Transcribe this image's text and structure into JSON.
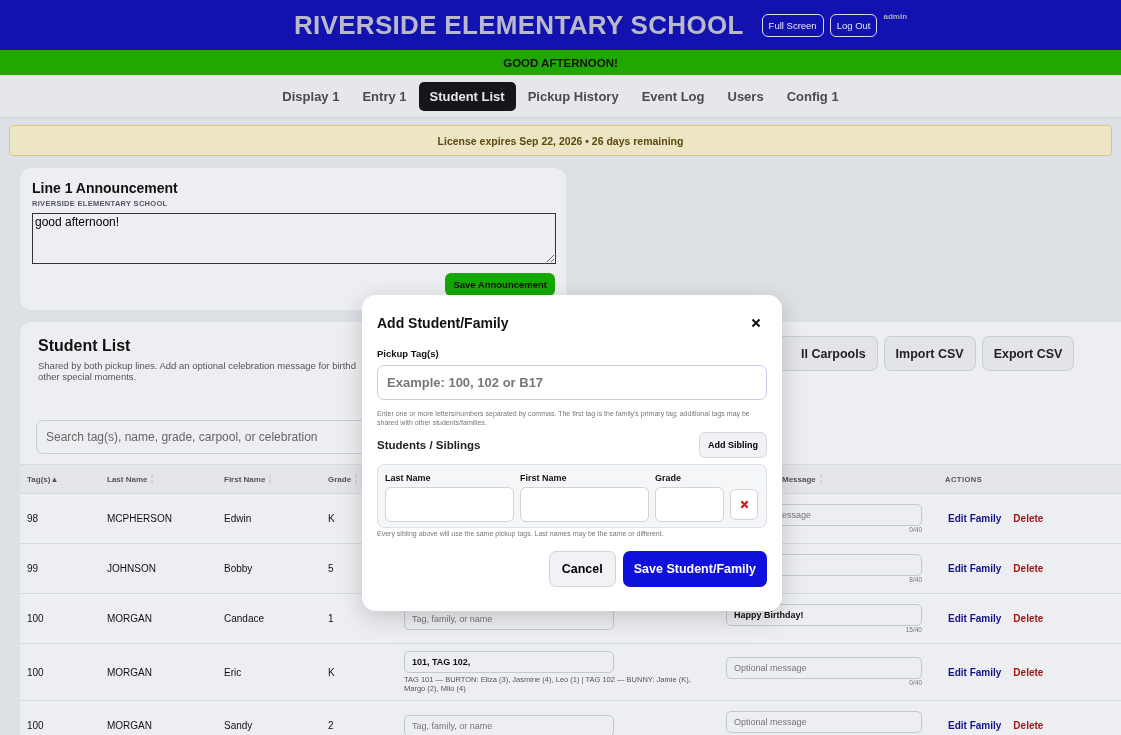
{
  "header": {
    "title": "RIVERSIDE ELEMENTARY SCHOOL",
    "buttons": [
      "Full Screen",
      "Log Out"
    ],
    "user": "admin"
  },
  "greeting": "GOOD AFTERNOON!",
  "tabs": [
    {
      "label": "Display 1",
      "selected": false
    },
    {
      "label": "Entry 1",
      "selected": false
    },
    {
      "label": "Student List",
      "selected": true
    },
    {
      "label": "Pickup History",
      "selected": false
    },
    {
      "label": "Event Log",
      "selected": false
    },
    {
      "label": "Users",
      "selected": false
    },
    {
      "label": "Config 1",
      "selected": false
    }
  ],
  "license": "License expires Sep 22, 2026 • 26 days remaining",
  "announcement": {
    "title": "Line 1 Announcement",
    "subtitle": "RIVERSIDE ELEMENTARY SCHOOL",
    "value": "good afternoon!",
    "button": "Save Announcement"
  },
  "student_list": {
    "title": "Student List",
    "description": [
      "Shared by both pickup lines. Add an optional celebration message for birthd",
      "other special moments."
    ],
    "buttons": [
      "ll Carpools",
      "Import CSV",
      "Export CSV"
    ],
    "search": {
      "placeholder": "Search tag(s), name, grade, carpool, or celebration"
    },
    "table": {
      "columns": [
        {
          "label": "Tag(s)",
          "sort_mark": "▲"
        },
        {
          "label": "Last Name",
          "sortable": true
        },
        {
          "label": "First Name",
          "sortable": true
        },
        {
          "label": "Grade",
          "sortable": true
        },
        {
          "label": "Message",
          "sortable": true
        },
        {
          "label": "ACTIONS",
          "sortable": false
        }
      ],
      "rows": [
        {
          "tag": "98",
          "last": "MCPHERSON",
          "first": "Edwin",
          "grade": "K",
          "celebration": {
            "placeholder": "essage",
            "counter": "0/40"
          },
          "actions": [
            "Edit Family",
            "Delete"
          ]
        },
        {
          "tag": "99",
          "last": "JOHNSON",
          "first": "Bobby",
          "grade": "5",
          "celebration": {
            "counter": "8/40"
          },
          "actions": [
            "Edit Family",
            "Delete"
          ]
        },
        {
          "tag": "100",
          "last": "MORGAN",
          "first": "Candace",
          "grade": "1",
          "carpool": {
            "placeholder": "Tag, family, or name"
          },
          "celebration": {
            "value": "Happy Birthday!",
            "counter": "15/40"
          },
          "actions": [
            "Edit Family",
            "Delete"
          ]
        },
        {
          "tag": "100",
          "last": "MORGAN",
          "first": "Eric",
          "grade": "K",
          "carpool": {
            "value": "101, TAG 102,",
            "note": "TAG 101 — BURTON: Eliza (3), Jasmine (4), Leo (1) | TAG 102 — BUNNY: Jamie (K), Margo (2), Milo (4)"
          },
          "celebration": {
            "placeholder": "Optional message",
            "counter": "0/40"
          },
          "actions": [
            "Edit Family",
            "Delete"
          ]
        },
        {
          "tag": "100",
          "last": "MORGAN",
          "first": "Sandy",
          "grade": "2",
          "carpool": {
            "placeholder": "Tag, family, or name"
          },
          "celebration": {
            "placeholder": "Optional message"
          },
          "actions": [
            "Edit Family",
            "Delete"
          ]
        }
      ]
    }
  },
  "modal": {
    "title": "Add Student/Family",
    "tag_label": "Pickup Tag(s)",
    "tag_placeholder": "Example: 100, 102 or B17",
    "tag_help": "Enter one or more letters/numbers separated by commas. The first tag is the family's primary tag; additional tags may be shared with other students/families.",
    "section": "Students / Siblings",
    "add_button": "Add Sibling",
    "sibling_columns": [
      "Last Name",
      "First Name",
      "Grade"
    ],
    "siblings": [
      {
        "removable": true
      }
    ],
    "note": "Every sibling above will use the same pickup tags. Last names may be the same or different.",
    "cancel": "Cancel",
    "save": "Save Student/Family"
  }
}
